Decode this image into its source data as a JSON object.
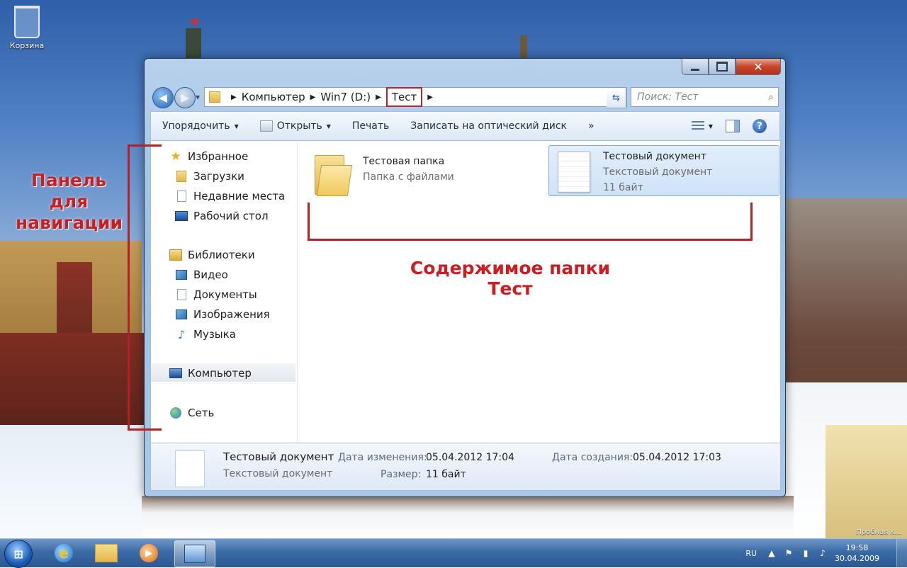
{
  "desktop": {
    "recycle_bin_label": "Корзина",
    "watermark": "Пробная к..."
  },
  "window": {
    "nav": {
      "back_icon": "back-arrow-icon",
      "forward_icon": "forward-arrow-icon"
    },
    "address": {
      "crumbs": [
        "Компьютер",
        "Win7 (D:)",
        "Тест"
      ]
    },
    "search": {
      "placeholder": "Поиск: Тест"
    },
    "toolbar": {
      "organize": "Упорядочить",
      "open": "Открыть",
      "print": "Печать",
      "burn": "Записать на оптический диск",
      "more": "»"
    },
    "nav_pane": {
      "favorites": "Избранное",
      "downloads": "Загрузки",
      "recent": "Недавние места",
      "desktop": "Рабочий стол",
      "libraries": "Библиотеки",
      "video": "Видео",
      "documents": "Документы",
      "pictures": "Изображения",
      "music": "Музыка",
      "computer": "Компьютер",
      "network": "Сеть"
    },
    "files": [
      {
        "name": "Тестовая папка",
        "type": "Папка с файлами",
        "size": ""
      },
      {
        "name": "Тестовый документ",
        "type": "Текстовый документ",
        "size": "11 байт"
      }
    ],
    "details": {
      "name": "Тестовый документ",
      "type": "Текстовый документ",
      "modified_label": "Дата изменения:",
      "modified_value": "05.04.2012 17:04",
      "size_label": "Размер:",
      "size_value": "11 байт",
      "created_label": "Дата создания:",
      "created_value": "05.04.2012 17:03"
    }
  },
  "annotations": {
    "nav_label": "Панель для навигации",
    "content_label": "Содержимое папки Тест",
    "color": "#c81f25"
  },
  "taskbar": {
    "language": "RU",
    "time": "19:58",
    "date": "30.04.2009"
  }
}
